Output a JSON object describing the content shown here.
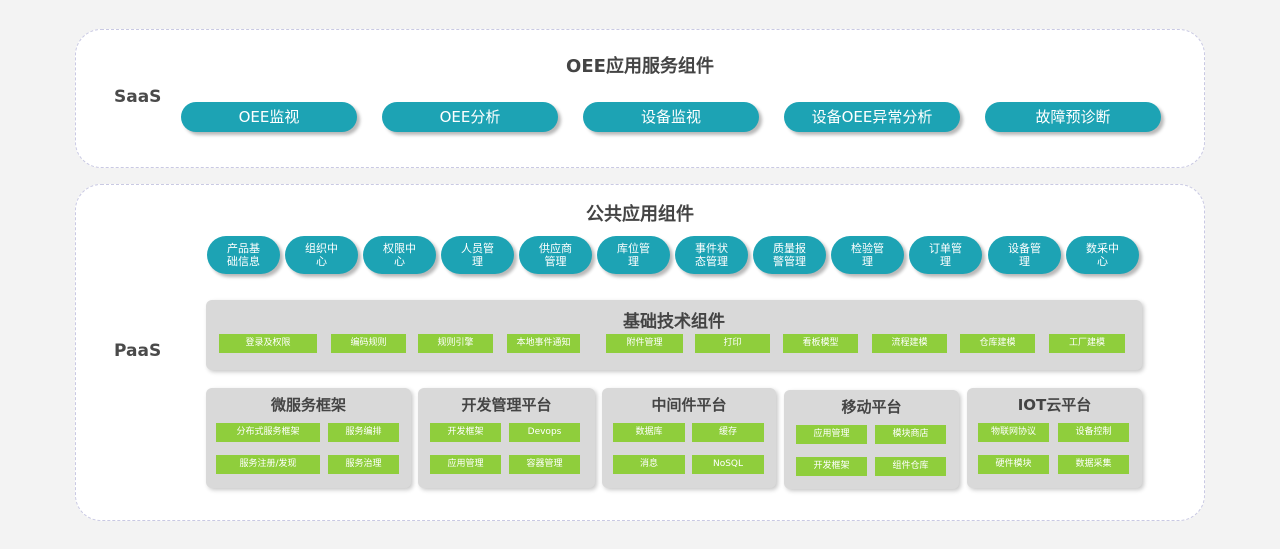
{
  "saas": {
    "label": "SaaS",
    "title": "OEE应用服务组件",
    "items": [
      "OEE监视",
      "OEE分析",
      "设备监视",
      "设备OEE异常分析",
      "故障预诊断"
    ]
  },
  "paas": {
    "label": "PaaS",
    "public": {
      "title": "公共应用组件",
      "items": [
        "产品基础信息",
        "组织中心",
        "权限中心",
        "人员管理",
        "供应商管理",
        "库位管理",
        "事件状态管理",
        "质量报警管理",
        "检验管理",
        "订单管理",
        "设备管理",
        "数采中心"
      ]
    },
    "basic": {
      "title": "基础技术组件",
      "items": [
        "登录及权限",
        "编码规则",
        "规则引擎",
        "本地事件通知",
        "附件管理",
        "打印",
        "看板模型",
        "流程建模",
        "仓库建模",
        "工厂建模"
      ]
    },
    "platforms": [
      {
        "title": "微服务框架",
        "items": [
          "分布式服务框架",
          "服务编排",
          "服务注册/发现",
          "服务治理"
        ]
      },
      {
        "title": "开发管理平台",
        "items": [
          "开发框架",
          "Devops",
          "应用管理",
          "容器管理"
        ]
      },
      {
        "title": "中间件平台",
        "items": [
          "数据库",
          "缓存",
          "消息",
          "NoSQL"
        ]
      },
      {
        "title": "移动平台",
        "items": [
          "应用管理",
          "模块商店",
          "开发框架",
          "组件仓库"
        ]
      },
      {
        "title": "IOT云平台",
        "items": [
          "物联网协议",
          "设备控制",
          "硬件模块",
          "数据采集"
        ]
      }
    ]
  }
}
